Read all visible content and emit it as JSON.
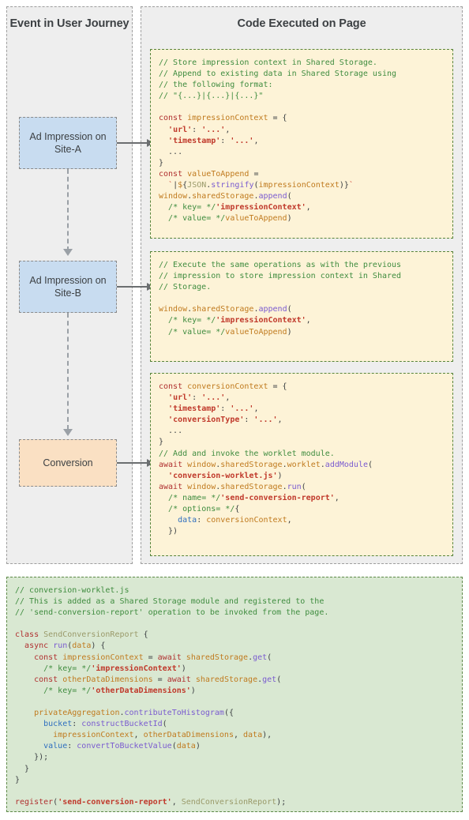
{
  "columns": {
    "left_header": "Event in User\nJourney",
    "right_header": "Code Executed on Page"
  },
  "events": [
    {
      "id": "event-a",
      "label": "Ad Impression\non Site-A",
      "color": "#c8dcf0"
    },
    {
      "id": "event-b",
      "label": "Ad Impression\non Site-B",
      "color": "#c8dcf0"
    },
    {
      "id": "event-c",
      "label": "Conversion",
      "color": "#fae0c3"
    }
  ],
  "code_blocks": [
    {
      "id": "code-1",
      "background": "#fdf3d7",
      "border": "#57843a",
      "text": "// Store impression context in Shared Storage.\n// Append to existing data in Shared Storage using\n// the following format:\n// \"{...}|{...}|{...}\"\n\nconst impressionContext = {\n  'url': '...',\n  'timestamp': '...',\n  ...\n}\nconst valueToAppend =\n  `|${JSON.stringify(impressionContext)}`\nwindow.sharedStorage.append(\n  /* key= */'impressionContext',\n  /* value= */valueToAppend)"
    },
    {
      "id": "code-2",
      "background": "#fdf3d7",
      "border": "#57843a",
      "text": "// Execute the same operations as with the previous\n// impression to store impression context in Shared\n// Storage.\n\nwindow.sharedStorage.append(\n  /* key= */'impressionContext',\n  /* value= */valueToAppend)"
    },
    {
      "id": "code-3",
      "background": "#fdf3d7",
      "border": "#57843a",
      "text": "const conversionContext = {\n  'url': '...',\n  'timestamp': '...',\n  'conversionType': '...',\n  ...\n}\n// Add and invoke the worklet module.\nawait window.sharedStorage.worklet.addModule(\n  'conversion-worklet.js')\nawait window.sharedStorage.run(\n  /* name= */'send-conversion-report',\n  /* options= */{\n    data: conversionContext,\n  })"
    }
  ],
  "worklet_block": {
    "id": "code-worklet",
    "background": "#d9e8d2",
    "border": "#5f8a4a",
    "text": "// conversion-worklet.js\n// This is added as a Shared Storage module and registered to the\n// 'send-conversion-report' operation to be invoked from the page.\n\nclass SendConversionReport {\n  async run(data) {\n    const impressionContext = await sharedStorage.get(\n      /* key= */'impressionContext')\n    const otherDataDimensions = await sharedStorage.get(\n      /* key= */'otherDataDimensions')\n\n    privateAggregation.contributeToHistogram({\n      bucket: constructBucketId(\n        impressionContext, otherDataDimensions, data),\n      value: convertToBucketValue(data)\n    });\n  }\n}\n\nregister('send-conversion-report', SendConversionReport);"
  },
  "arrows": {
    "color": "#6b6e70",
    "connector_color": "#9aa0a6"
  }
}
